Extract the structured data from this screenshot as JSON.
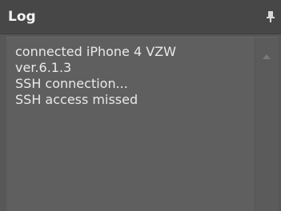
{
  "panel": {
    "title": "Log",
    "pin_icon": "pin-icon",
    "scroll_up_icon": "chevron-up-icon"
  },
  "log": {
    "lines": [
      "connected iPhone 4 VZW",
      "ver.6.1.3",
      "SSH connection...",
      "SSH access missed"
    ]
  },
  "colors": {
    "header_bg": "#474747",
    "content_bg": "#5f5f5f",
    "text": "#e9e9e9"
  }
}
